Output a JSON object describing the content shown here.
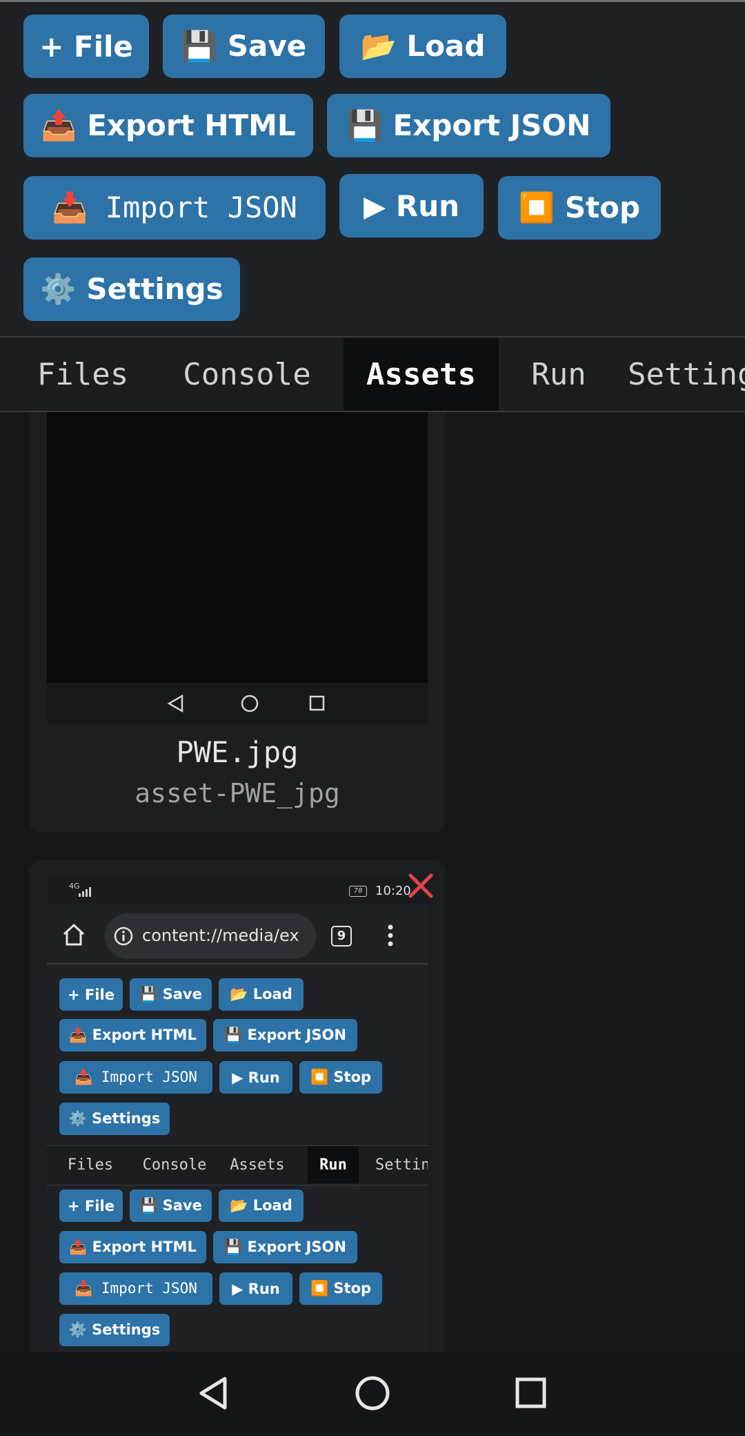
{
  "toolbar": {
    "file": "+ File",
    "save": "💾 Save",
    "load": "📂 Load",
    "export_html": "📤 Export HTML",
    "export_json": "💾 Export JSON",
    "import_json": "📥 Import JSON",
    "run": "▶ Run",
    "stop": "⏹️ Stop",
    "settings": "⚙️ Settings"
  },
  "tabs": [
    "Files",
    "Console",
    "Assets",
    "Run",
    "Settings"
  ],
  "active_tab": "Assets",
  "assets": [
    {
      "filename": "PWE.jpg",
      "asset_id": "asset-PWE_jpg"
    }
  ],
  "screenshot_thumb": {
    "signal": "4G",
    "battery": "78",
    "time": "10:20",
    "url": "content://media/ex",
    "tab_count": "9",
    "active_tab": "Run"
  },
  "colors": {
    "button_bg": "#2e73a8",
    "background": "#16171b",
    "remove_x": "#e0474c"
  }
}
